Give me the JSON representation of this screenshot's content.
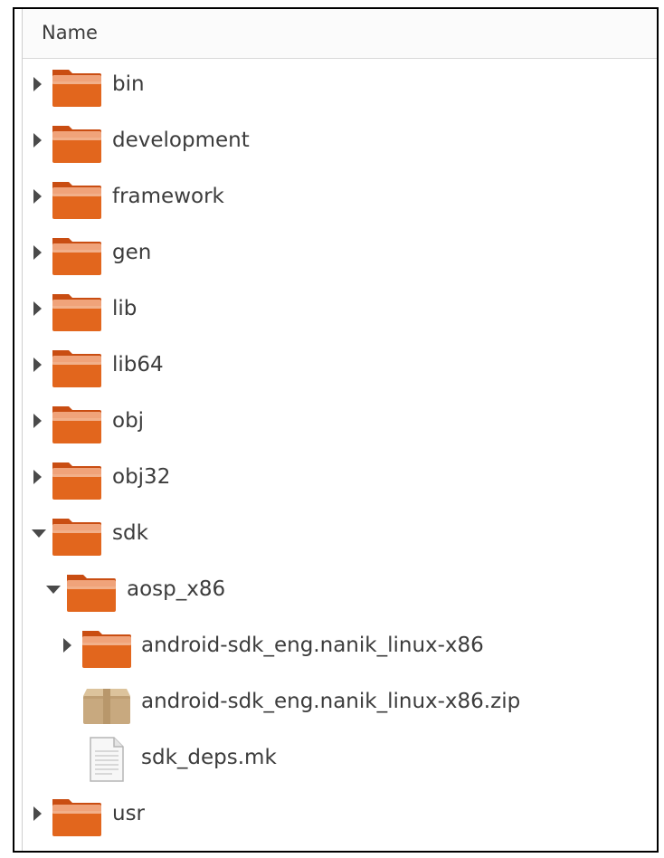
{
  "header": {
    "column_name": "Name"
  },
  "rows": [
    {
      "label": "bin",
      "kind": "folder",
      "expander": "collapsed",
      "icon": "folder-icon"
    },
    {
      "label": "development",
      "kind": "folder",
      "expander": "collapsed",
      "icon": "folder-icon"
    },
    {
      "label": "framework",
      "kind": "folder",
      "expander": "collapsed",
      "icon": "folder-icon"
    },
    {
      "label": "gen",
      "kind": "folder",
      "expander": "collapsed",
      "icon": "folder-icon"
    },
    {
      "label": "lib",
      "kind": "folder",
      "expander": "collapsed",
      "icon": "folder-icon"
    },
    {
      "label": "lib64",
      "kind": "folder",
      "expander": "collapsed",
      "icon": "folder-icon"
    },
    {
      "label": "obj",
      "kind": "folder",
      "expander": "collapsed",
      "icon": "folder-icon"
    },
    {
      "label": "obj32",
      "kind": "folder",
      "expander": "collapsed",
      "icon": "folder-icon"
    },
    {
      "label": "sdk",
      "kind": "folder",
      "expander": "expanded",
      "icon": "folder-icon"
    },
    {
      "label": "aosp_x86",
      "kind": "folder",
      "expander": "expanded",
      "icon": "folder-icon"
    },
    {
      "label": "android-sdk_eng.nanik_linux-x86",
      "kind": "folder",
      "expander": "collapsed",
      "icon": "folder-icon"
    },
    {
      "label": "android-sdk_eng.nanik_linux-x86.zip",
      "kind": "archive",
      "expander": "none",
      "icon": "archive-icon"
    },
    {
      "label": "sdk_deps.mk",
      "kind": "document",
      "expander": "none",
      "icon": "document-icon"
    },
    {
      "label": "usr",
      "kind": "folder",
      "expander": "collapsed",
      "icon": "folder-icon"
    }
  ],
  "colors": {
    "folder_top": "#f0a37a",
    "folder_body": "#e2661d",
    "folder_dark": "#c94d12",
    "archive_body": "#c8a97f",
    "text": "#3c3c3c"
  }
}
